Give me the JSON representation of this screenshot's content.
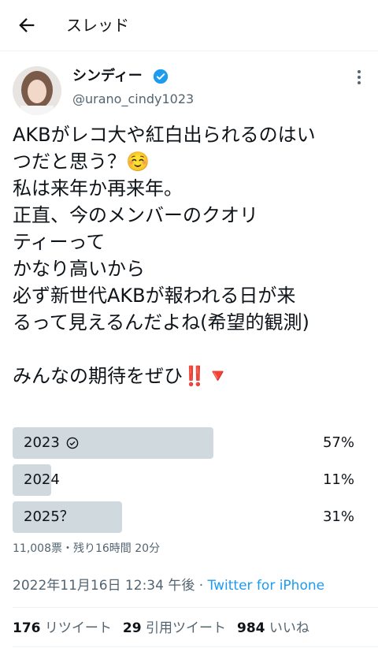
{
  "header": {
    "title": "スレッド",
    "back_icon": "arrow-left-icon"
  },
  "author": {
    "name": "シンディー",
    "handle": "@urano_cindy1023",
    "verified": true,
    "avatar_icon": "avatar-photo"
  },
  "tweet": {
    "lines": [
      "AKBがレコ大や紅白出られるのはい",
      "つだと思う？",
      "私は来年か再来年。",
      "正直、今のメンバーのクオリ",
      "ティーって",
      "かなり高いから",
      "必ず新世代AKBが報われる日が来",
      "るって見えるんだよね(希望的観測)",
      "",
      "みんなの期待をぜひ"
    ],
    "emoji_blush": "☺️",
    "emoji_bang": "‼️",
    "emoji_triangle": "🔻"
  },
  "poll": {
    "options": [
      {
        "label": "2023",
        "percent_text": "57%",
        "percent": 57,
        "winner": true
      },
      {
        "label": "2024",
        "percent_text": "11%",
        "percent": 11,
        "winner": false
      },
      {
        "label": "2025？",
        "percent_text": "31%",
        "percent": 31,
        "winner": false
      }
    ],
    "meta": "11,008票・残り16時間 20分"
  },
  "timestamp": {
    "date": "2022年11月16日 12:34 午後",
    "separator": " · ",
    "source": "Twitter for iPhone"
  },
  "stats": {
    "retweets_count": "176",
    "retweets_label": "リツイート",
    "quotes_count": "29",
    "quotes_label": "引用ツイート",
    "likes_count": "984",
    "likes_label": "いいね"
  },
  "colors": {
    "accent": "#1d9bf0",
    "poll_fill": "#cfd9de",
    "secondary_text": "#536471"
  }
}
